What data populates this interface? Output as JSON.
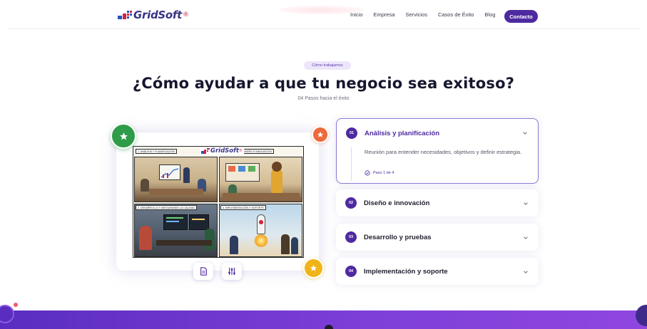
{
  "header": {
    "logo_text": "GridSoft",
    "logo_mark": "®",
    "nav": [
      "Inicio",
      "Empresa",
      "Servicios",
      "Casos de Éxito",
      "Blog"
    ],
    "contact_label": "Contacto"
  },
  "hero": {
    "badge": "Cómo trabajamos",
    "title": "¿Cómo ayudar a que tu negocio sea exitoso?",
    "subtitle": "04 Pasos hacia el éxito"
  },
  "illustration": {
    "logo_text": "GridSoft",
    "logo_mark": "®",
    "panels": [
      "1. ANÁLISIS Y PLANIFICACIÓN",
      "2. DISEÑO E INNOVACIÓN",
      "3. DESARROLLO Y ASEGURANDO LA CALIDAD",
      "4. IMPLEMENTACIÓN Y SOPORTE"
    ]
  },
  "steps": [
    {
      "num": "01",
      "title": "Análisis y planificación",
      "description": "Reunión para entender necesidades, objetivos y definir estrategia.",
      "progress": "Paso 1 de 4",
      "expanded": true
    },
    {
      "num": "02",
      "title": "Diseño e innovación",
      "expanded": false
    },
    {
      "num": "03",
      "title": "Desarrollo y pruebas",
      "expanded": false
    },
    {
      "num": "04",
      "title": "Implementación y soporte",
      "expanded": false
    }
  ],
  "colors": {
    "primary": "#4e2aa0",
    "accent_green": "#2e9c48",
    "accent_orange": "#ec6a3c",
    "accent_yellow": "#f0b419"
  },
  "icons": {
    "card_badges": [
      "star-icon",
      "star-icon",
      "star-icon"
    ],
    "mini_buttons": [
      "document-icon",
      "sliders-icon"
    ],
    "accordion": [
      "chevron-down-icon",
      "check-circle-icon"
    ]
  }
}
